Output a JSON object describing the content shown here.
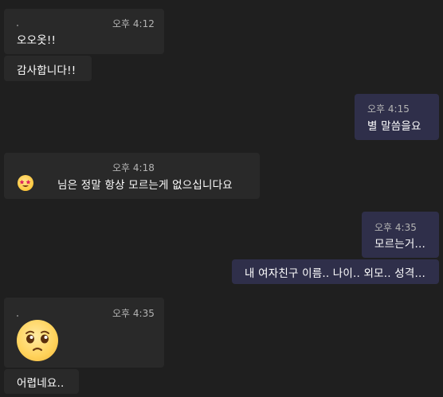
{
  "messages": [
    {
      "direction": "in",
      "time": "오후 4:12",
      "text": "오오옷!!"
    },
    {
      "direction": "in",
      "text": "감사합니다!!"
    },
    {
      "direction": "out",
      "time": "오후 4:15",
      "text": "별 말씀을요"
    },
    {
      "direction": "in",
      "time": "오후 4:18",
      "text": "님은 정말 항상 모르는게 없으십니다요",
      "emoji": "star-struck-face-icon"
    },
    {
      "direction": "out",
      "time": "오후 4:35",
      "text": "모르는거..."
    },
    {
      "direction": "out",
      "text": "내 여자친구 이름.. 나이.. 외모.. 성격..."
    },
    {
      "direction": "in",
      "time": "오후 4:35",
      "emoji": "pleading-face-icon"
    },
    {
      "direction": "in",
      "text": "어렵네요.."
    }
  ],
  "colors": {
    "background": "#1f1f1f",
    "incoming_bubble": "#292929",
    "outgoing_bubble": "#2f2f4a",
    "timestamp": "#b3b3b3",
    "text": "#ffffff"
  }
}
